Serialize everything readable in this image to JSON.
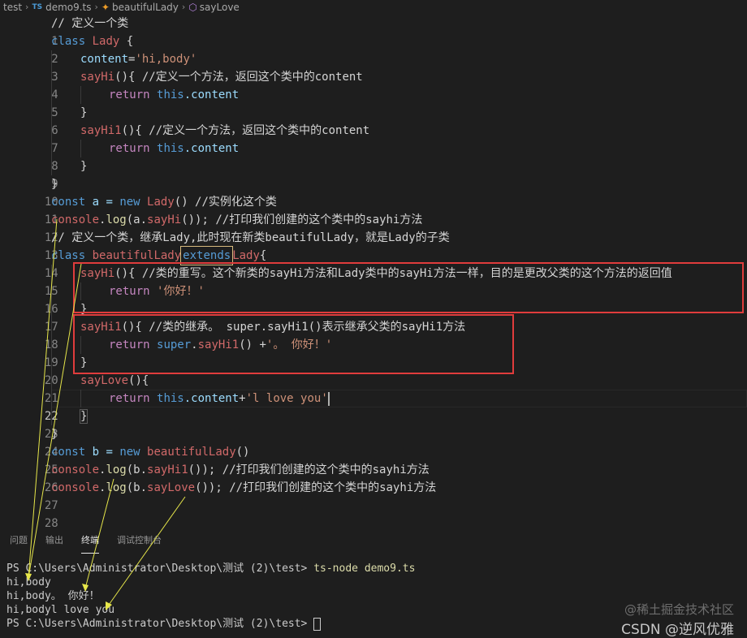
{
  "breadcrumb": {
    "folder": "test",
    "file_badge": "TS",
    "file": "demo9.ts",
    "class": "beautifulLady",
    "method": "sayLove"
  },
  "editor": {
    "line_numbers": [
      "1",
      "2",
      "3",
      "4",
      "5",
      "6",
      "7",
      "8",
      "9",
      "10",
      "11",
      "12",
      "13",
      "14",
      "15",
      "16",
      "17",
      "18",
      "19",
      "20",
      "21",
      "22",
      "23",
      "24",
      "25",
      "26",
      "27",
      "28"
    ],
    "code": {
      "l1_cmt": "// 定义一个类",
      "kw_class": "class",
      "cls_lady": "Lady",
      "brace_open": " {",
      "brace_close": "}",
      "l3_prop": "content",
      "l3_eq": "=",
      "l3_str": "'hi,body'",
      "fn_sayhi": "sayHi",
      "fn_sayhi1": "sayHi1",
      "fn_saylove": "sayLove",
      "parens_brace": "(){",
      "l4_cmt": " //定义一个方法，返回这个类中的content",
      "kw_return": "return",
      "kw_this": "this",
      "dot_content": ".content",
      "l7_cmt": " //定义一个方法，返回这个类中的content",
      "kw_const": "const",
      "var_a": " a = ",
      "kw_new": "new",
      "l11_call": "()",
      "l11_cmt": " //实例化这个类",
      "console": "console",
      "dot": ".",
      "log": "log",
      "l12_args_a": "(a.",
      "l12_tail": "());",
      "l12_cmt": " //打印我们创建的这个类中的sayhi方法",
      "l13_cmt": "// 定义一个类，继承Lady,此时现在新类beautifulLady，就是Lady的子类",
      "cls_beautiful": "beautifulLady",
      "kw_extends": "extends",
      "brace_nospace": "{",
      "l15_cmt": " //类的重写。这个新类的sayHi方法和Lady类中的sayHi方法一样，目的是更改父类的这个方法的返回值",
      "l16_str": "'你好！'",
      "l18_cmt": " //类的继承。 super.sayHi1()表示继承父类的sayHi1方法",
      "kw_super": "super",
      "l19_call": "() +",
      "l19_str": "'。 你好！'",
      "l21_paren": "()",
      "l22_plus": "+",
      "l22_str": "'l love you'",
      "var_b": " b = ",
      "l25_call": "()",
      "l26_args_b": "(b.",
      "l26_tail": "());",
      "l26_cmt": " //打印我们创建的这个类中的sayhi方法",
      "l27_cmt": " //打印我们创建的这个类中的sayhi方法"
    }
  },
  "panel": {
    "tabs": [
      "问题",
      "输出",
      "终端",
      "调试控制台"
    ],
    "active_tab": "终端"
  },
  "terminal": {
    "prompt": "PS C:\\Users\\Administrator\\Desktop\\测试 (2)\\test> ",
    "command": "ts-node demo9.ts",
    "outputs": [
      "hi,body",
      "hi,body。 你好！",
      "hi,bodyl love you"
    ]
  },
  "watermark": {
    "line1": "@稀土掘金技术社区",
    "line2": "CSDN @逆风优雅"
  },
  "colors": {
    "background": "#1e1e1e",
    "keyword": "#569cd6",
    "class_name": "#d16969",
    "function": "#dcdcaa",
    "property": "#9cdcfe",
    "string": "#ce9178",
    "annotation_box": "#e03c3c",
    "annotation_arrow": "#e6e64a"
  }
}
